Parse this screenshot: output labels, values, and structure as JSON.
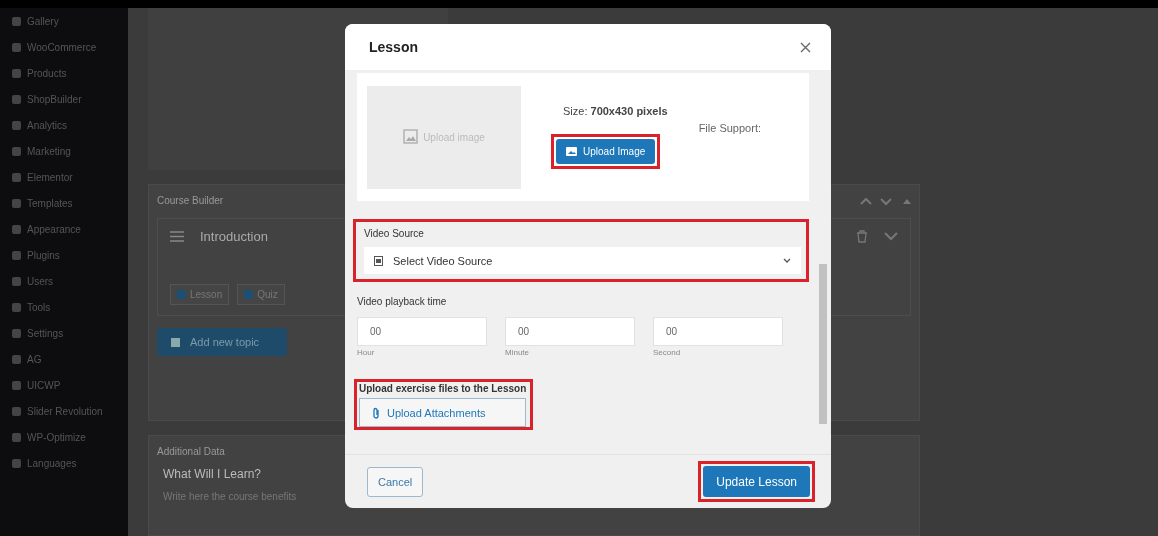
{
  "sidebar": {
    "items": [
      {
        "label": "Gallery"
      },
      {
        "label": "WooCommerce"
      },
      {
        "label": "Products"
      },
      {
        "label": "ShopBuilder"
      },
      {
        "label": "Analytics"
      },
      {
        "label": "Marketing"
      },
      {
        "label": "Elementor"
      },
      {
        "label": "Templates"
      },
      {
        "label": "Appearance"
      },
      {
        "label": "Plugins"
      },
      {
        "label": "Users"
      },
      {
        "label": "Tools"
      },
      {
        "label": "Settings"
      },
      {
        "label": "AG"
      },
      {
        "label": "UICWP"
      },
      {
        "label": "Slider Revolution"
      },
      {
        "label": "WP-Optimize"
      },
      {
        "label": "Languages"
      }
    ]
  },
  "course_builder": {
    "title": "Course Builder",
    "topic": {
      "title": "Introduction",
      "buttons": [
        "Lesson",
        "Quiz"
      ]
    },
    "add_button": "Add new topic"
  },
  "additional_data": {
    "title": "Additional Data",
    "question": "What Will I Learn?",
    "placeholder": "Write here the course benefits"
  },
  "modal": {
    "title": "Lesson",
    "image": {
      "placeholder": "Upload image",
      "size": "Size:  **700x430 pixels**",
      "file_support": "File Support:",
      "button": "Upload Image",
      "highlighted": true
    },
    "video_source": {
      "label": "Video Source",
      "placeholder": "Select Video Source",
      "highlighted": true
    },
    "playback": {
      "label": "Video playback time",
      "fields": [
        {
          "value": "00",
          "caption": "Hour"
        },
        {
          "value": "00",
          "caption": "Minute"
        },
        {
          "value": "00",
          "caption": "Second"
        }
      ]
    },
    "exercise": {
      "label": "Upload exercise files to the Lesson",
      "button": "Upload Attachments",
      "highlighted": true
    },
    "footer": {
      "cancel": "Cancel",
      "submit": "Update Lesson",
      "submit_highlighted": true
    }
  }
}
